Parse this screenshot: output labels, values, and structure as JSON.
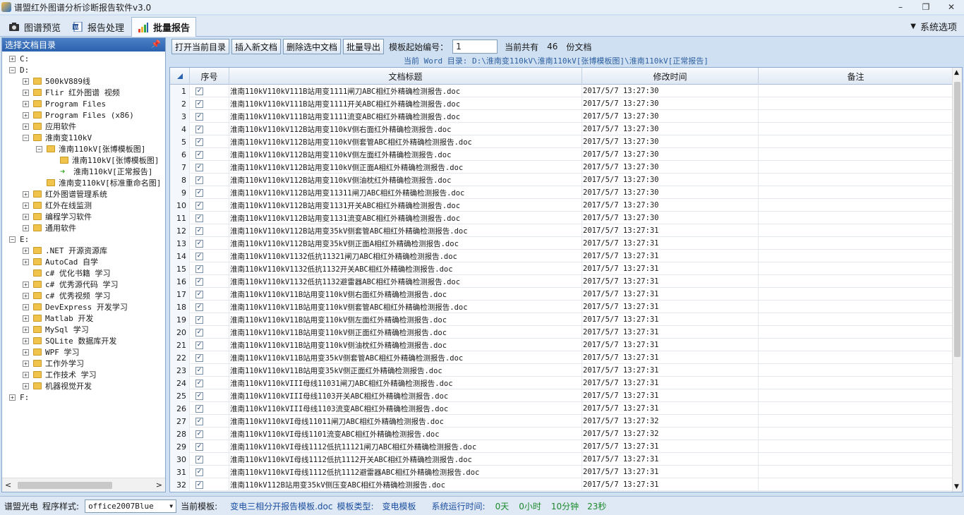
{
  "app": {
    "title": "谱盟红外图谱分析诊断报告软件v3.0"
  },
  "window_buttons": [
    "–",
    "❐",
    "✕"
  ],
  "tabs": [
    {
      "label": "图谱预览",
      "icon": "camera-icon"
    },
    {
      "label": "报告处理",
      "icon": "word-doc-icon"
    },
    {
      "label": "批量报告",
      "icon": "bar-chart-icon",
      "active": true
    }
  ],
  "system_options": "系统选项",
  "left_pane": {
    "header": "选择文档目录",
    "tree": [
      {
        "label": "C:",
        "depth": 0,
        "expander": "+",
        "icon": "none"
      },
      {
        "label": "D:",
        "depth": 0,
        "expander": "-",
        "icon": "none"
      },
      {
        "label": "500kV889线",
        "depth": 1,
        "expander": "+",
        "icon": "folder"
      },
      {
        "label": "Flir 红外图谱  视频",
        "depth": 1,
        "expander": "+",
        "icon": "folder"
      },
      {
        "label": "Program Files",
        "depth": 1,
        "expander": "+",
        "icon": "folder"
      },
      {
        "label": "Program Files (x86)",
        "depth": 1,
        "expander": "+",
        "icon": "folder"
      },
      {
        "label": "应用软件",
        "depth": 1,
        "expander": "+",
        "icon": "folder"
      },
      {
        "label": "淮南变110kV",
        "depth": 1,
        "expander": "-",
        "icon": "folder"
      },
      {
        "label": "淮南110kV[张博模板图]",
        "depth": 2,
        "expander": "-",
        "icon": "folder"
      },
      {
        "label": "淮南110kV[张博模板图]",
        "depth": 3,
        "expander": "",
        "icon": "folder"
      },
      {
        "label": "淮南110kV[正常报告]",
        "depth": 3,
        "expander": "",
        "icon": "arrow"
      },
      {
        "label": "淮南变110kV[标准重命名图]",
        "depth": 2,
        "expander": "",
        "icon": "folder"
      },
      {
        "label": "红外图谱管理系统",
        "depth": 1,
        "expander": "+",
        "icon": "folder"
      },
      {
        "label": "红外在线监测",
        "depth": 1,
        "expander": "+",
        "icon": "folder"
      },
      {
        "label": "编程学习软件",
        "depth": 1,
        "expander": "+",
        "icon": "folder"
      },
      {
        "label": "通用软件",
        "depth": 1,
        "expander": "+",
        "icon": "folder"
      },
      {
        "label": "E:",
        "depth": 0,
        "expander": "-",
        "icon": "none"
      },
      {
        "label": ".NET 开源资源库",
        "depth": 1,
        "expander": "+",
        "icon": "folder"
      },
      {
        "label": "AutoCad 自学",
        "depth": 1,
        "expander": "+",
        "icon": "folder"
      },
      {
        "label": "c# 优化书籍 学习",
        "depth": 1,
        "expander": "",
        "icon": "folder"
      },
      {
        "label": "c# 优秀源代码 学习",
        "depth": 1,
        "expander": "+",
        "icon": "folder"
      },
      {
        "label": "c# 优秀视频 学习",
        "depth": 1,
        "expander": "+",
        "icon": "folder"
      },
      {
        "label": "DevExpress 开发学习",
        "depth": 1,
        "expander": "+",
        "icon": "folder"
      },
      {
        "label": "Matlab 开发",
        "depth": 1,
        "expander": "+",
        "icon": "folder"
      },
      {
        "label": "MySql 学习",
        "depth": 1,
        "expander": "+",
        "icon": "folder"
      },
      {
        "label": "SQLite 数据库开发",
        "depth": 1,
        "expander": "+",
        "icon": "folder"
      },
      {
        "label": "WPF  学习",
        "depth": 1,
        "expander": "+",
        "icon": "folder"
      },
      {
        "label": "工作外学习",
        "depth": 1,
        "expander": "+",
        "icon": "folder"
      },
      {
        "label": "工作技术 学习",
        "depth": 1,
        "expander": "+",
        "icon": "folder"
      },
      {
        "label": "机器视觉开发",
        "depth": 1,
        "expander": "+",
        "icon": "folder"
      },
      {
        "label": "F:",
        "depth": 0,
        "expander": "+",
        "icon": "none"
      }
    ]
  },
  "toolbar": {
    "open_dir": "打开当前目录",
    "insert_doc": "插入新文档",
    "delete_doc": "删除选中文档",
    "batch_export": "批量导出",
    "start_no_label": "模板起始编号：",
    "start_no_value": "1",
    "total_label": "当前共有",
    "total_count": "46",
    "total_unit": "份文档"
  },
  "current_dir": "当前 Word 目录:  D:\\淮南变110kV\\淮南110kV[张博模板图]\\淮南110kV[正常报告]",
  "grid": {
    "headers": {
      "seq": "序号",
      "title": "文档标题",
      "modified": "修改时间",
      "note": "备注"
    },
    "rows": [
      {
        "n": "1",
        "title": "淮南110kV110kV111B站用变1111闸刀ABC相红外精确检测报告.doc",
        "time": "2017/5/7 13:27:30"
      },
      {
        "n": "2",
        "title": "淮南110kV110kV111B站用变1111开关ABC相红外精确检测报告.doc",
        "time": "2017/5/7 13:27:30"
      },
      {
        "n": "3",
        "title": "淮南110kV110kV111B站用变1111流变ABC相红外精确检测报告.doc",
        "time": "2017/5/7 13:27:30"
      },
      {
        "n": "4",
        "title": "淮南110kV110kV112B站用变110kV侧右面红外精确检测报告.doc",
        "time": "2017/5/7 13:27:30"
      },
      {
        "n": "5",
        "title": "淮南110kV110kV112B站用变110kV侧套管ABC相红外精确检测报告.doc",
        "time": "2017/5/7 13:27:30"
      },
      {
        "n": "6",
        "title": "淮南110kV110kV112B站用变110kV侧左面红外精确检测报告.doc",
        "time": "2017/5/7 13:27:30"
      },
      {
        "n": "7",
        "title": "淮南110kV110kV112B站用变110kV侧正面A相红外精确检测报告.doc",
        "time": "2017/5/7 13:27:30"
      },
      {
        "n": "8",
        "title": "淮南110kV110kV112B站用变110kV侧油枕红外精确检测报告.doc",
        "time": "2017/5/7 13:27:30"
      },
      {
        "n": "9",
        "title": "淮南110kV110kV112B站用变11311闸刀ABC相红外精确检测报告.doc",
        "time": "2017/5/7 13:27:30"
      },
      {
        "n": "10",
        "title": "淮南110kV110kV112B站用变1131开关ABC相红外精确检测报告.doc",
        "time": "2017/5/7 13:27:30"
      },
      {
        "n": "11",
        "title": "淮南110kV110kV112B站用变1131流变ABC相红外精确检测报告.doc",
        "time": "2017/5/7 13:27:30"
      },
      {
        "n": "12",
        "title": "淮南110kV110kV112B站用变35kV侧套管ABC相红外精确检测报告.doc",
        "time": "2017/5/7 13:27:31"
      },
      {
        "n": "13",
        "title": "淮南110kV110kV112B站用变35kV侧正面A相红外精确检测报告.doc",
        "time": "2017/5/7 13:27:31"
      },
      {
        "n": "14",
        "title": "淮南110kV110kV1132低抗11321闸刀ABC相红外精确检测报告.doc",
        "time": "2017/5/7 13:27:31"
      },
      {
        "n": "15",
        "title": "淮南110kV110kV1132低抗1132开关ABC相红外精确检测报告.doc",
        "time": "2017/5/7 13:27:31"
      },
      {
        "n": "16",
        "title": "淮南110kV110kV1132低抗1132避雷器ABC相红外精确检测报告.doc",
        "time": "2017/5/7 13:27:31"
      },
      {
        "n": "17",
        "title": "淮南110kV110kV11B站用变110kV侧右面红外精确检测报告.doc",
        "time": "2017/5/7 13:27:31"
      },
      {
        "n": "18",
        "title": "淮南110kV110kV11B站用变110kV侧套管ABC相红外精确检测报告.doc",
        "time": "2017/5/7 13:27:31"
      },
      {
        "n": "19",
        "title": "淮南110kV110kV11B站用变110kV侧左面红外精确检测报告.doc",
        "time": "2017/5/7 13:27:31"
      },
      {
        "n": "20",
        "title": "淮南110kV110kV11B站用变110kV侧正面红外精确检测报告.doc",
        "time": "2017/5/7 13:27:31"
      },
      {
        "n": "21",
        "title": "淮南110kV110kV11B站用变110kV侧油枕红外精确检测报告.doc",
        "time": "2017/5/7 13:27:31"
      },
      {
        "n": "22",
        "title": "淮南110kV110kV11B站用变35kV侧套管ABC相红外精确检测报告.doc",
        "time": "2017/5/7 13:27:31"
      },
      {
        "n": "23",
        "title": "淮南110kV110kV11B站用变35kV侧正面红外精确检测报告.doc",
        "time": "2017/5/7 13:27:31"
      },
      {
        "n": "24",
        "title": "淮南110kV110kVIII母线11031闸刀ABC相红外精确检测报告.doc",
        "time": "2017/5/7 13:27:31"
      },
      {
        "n": "25",
        "title": "淮南110kV110kVIII母线1103开关ABC相红外精确检测报告.doc",
        "time": "2017/5/7 13:27:31"
      },
      {
        "n": "26",
        "title": "淮南110kV110kVIII母线1103流变ABC相红外精确检测报告.doc",
        "time": "2017/5/7 13:27:31"
      },
      {
        "n": "27",
        "title": "淮南110kV110kVI母线11011闸刀ABC相红外精确检测报告.doc",
        "time": "2017/5/7 13:27:32"
      },
      {
        "n": "28",
        "title": "淮南110kV110kVI母线1101流变ABC相红外精确检测报告.doc",
        "time": "2017/5/7 13:27:32"
      },
      {
        "n": "29",
        "title": "淮南110kV110kVI母线1112低抗11121闸刀ABC相红外精确检测报告.doc",
        "time": "2017/5/7 13:27:31"
      },
      {
        "n": "30",
        "title": "淮南110kV110kVI母线1112低抗1112开关ABC相红外精确检测报告.doc",
        "time": "2017/5/7 13:27:31"
      },
      {
        "n": "31",
        "title": "淮南110kV110kVI母线1112低抗1112避雷器ABC相红外精确检测报告.doc",
        "time": "2017/5/7 13:27:31"
      },
      {
        "n": "32",
        "title": "淮南110kV112B站用变35kV侧压变ABC相红外精确检测报告.doc",
        "time": "2017/5/7 13:27:31"
      }
    ]
  },
  "status": {
    "company": "谱盟光电",
    "style_label": "程序样式:",
    "style_value": "office2007Blue",
    "template_label": "当前模板:",
    "template_value": "变电三相分开报告模板.doc",
    "type_label": "模板类型:",
    "type_value": "变电模板",
    "runtime_label": "系统运行时间:",
    "days": "0天",
    "hours": "0小时",
    "minutes": "10分钟",
    "seconds": "23秒"
  },
  "colors": {
    "accent": "#2b62ae",
    "green": "#1a8a2a",
    "blue_text": "#2d5f9f"
  }
}
